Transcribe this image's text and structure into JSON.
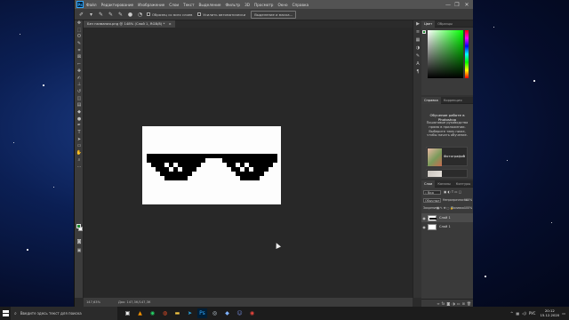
{
  "menubar": {
    "logo": "Ps",
    "items": [
      "Файл",
      "Редактирование",
      "Изображение",
      "Слои",
      "Текст",
      "Выделение",
      "Фильтр",
      "3D",
      "Просмотр",
      "Окно",
      "Справка"
    ],
    "minimize": "—",
    "restore": "❐",
    "close": "✕"
  },
  "options": {
    "refine_label": "Образец со всех слоев",
    "auto_enhance_label": "Усилить автоматически",
    "select_and_mask_button": "Выделение и маска..."
  },
  "document": {
    "tab_label": "Без названия.png @ 148% (Слой 1, RGB/8) *",
    "tab_close": "×"
  },
  "status": {
    "zoom": "147,63%",
    "doc_info": "Док: 147,3К/147,3К"
  },
  "panels": {
    "color_tabs": [
      "Цвет",
      "Образцы"
    ],
    "learn_tabs": [
      "Справка",
      "Коррекция"
    ],
    "learn": {
      "title": "Обучение работе в Photoshop",
      "description": "Пошаговые руководства прямо в приложении. Выберите тему ниже, чтобы начать обучение.",
      "card_label": "Фотография",
      "card_arrow": "›"
    },
    "layers_tabs": [
      "Слои",
      "Каналы",
      "Контуры"
    ],
    "layers": {
      "filter_kind": "Вид",
      "blend_mode": "Обычные",
      "opacity_label": "Непрозрачность:",
      "opacity_value": "100%",
      "lock_label": "Закрепить:",
      "fill_label": "Заливка:",
      "fill_value": "100%",
      "items": [
        {
          "name": "Слой 1",
          "selected": true
        },
        {
          "name": "Слой 1",
          "selected": false
        }
      ]
    }
  },
  "taskbar": {
    "search_placeholder": "Введите здесь текст для поиска",
    "tray_lang": "РУС",
    "time": "20:12",
    "date": "15.12.2020"
  },
  "colors": {
    "foreground": "#1b8a2f",
    "background": "#ffffff",
    "ps_blue": "#31a8ff"
  }
}
